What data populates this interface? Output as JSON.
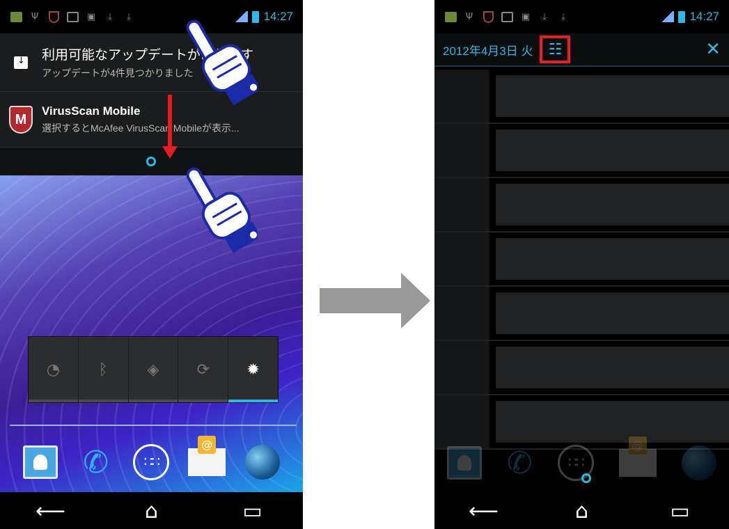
{
  "status_bar": {
    "time": "14:27"
  },
  "left_screen": {
    "notifications": [
      {
        "title": "利用可能なアップデートがあります",
        "subtitle": "アップデートが4件見つかりました",
        "icon": "update-bag-icon"
      },
      {
        "title": "VirusScan Mobile",
        "subtitle": "選択するとMcAfee VirusScan Mobileが表示...",
        "icon": "mcafee-shield-icon",
        "icon_letter": "M"
      }
    ],
    "power_widget": [
      "wifi-icon",
      "bluetooth-icon",
      "gps-icon",
      "sync-icon",
      "brightness-icon"
    ],
    "dock_apps": [
      "contacts-icon",
      "phone-icon",
      "app-drawer-icon",
      "email-icon",
      "browser-icon"
    ],
    "navbar": {
      "back": "⟵",
      "home": "⌂",
      "recents": "▭"
    }
  },
  "right_screen": {
    "header_date": "2012年4月3日 火",
    "settings_icon": "☷",
    "close_icon": "✕",
    "notification_rows": 7,
    "navbar": {
      "back": "⟵",
      "home": "⌂",
      "recents": "▭"
    }
  },
  "colors": {
    "accent": "#33b5e5",
    "highlight_red": "#e81e1e",
    "arrow_gray": "#999999"
  }
}
